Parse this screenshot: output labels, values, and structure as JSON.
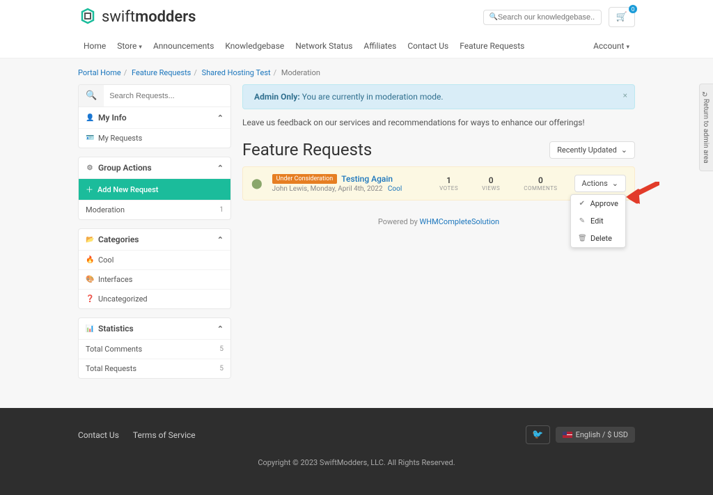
{
  "brand": {
    "part1": "swift",
    "part2": "modders"
  },
  "header": {
    "search_placeholder": "Search our knowledgebase...",
    "cart_count": "0",
    "nav": {
      "home": "Home",
      "store": "Store",
      "announcements": "Announcements",
      "knowledgebase": "Knowledgebase",
      "network_status": "Network Status",
      "affiliates": "Affiliates",
      "contact_us": "Contact Us",
      "feature_requests": "Feature Requests",
      "account": "Account"
    }
  },
  "breadcrumb": {
    "portal_home": "Portal Home",
    "feature_requests": "Feature Requests",
    "shared_hosting_test": "Shared Hosting Test",
    "current": "Moderation"
  },
  "sidebar": {
    "search_placeholder": "Search Requests...",
    "my_info": {
      "title": "My Info",
      "my_requests": "My Requests"
    },
    "group_actions": {
      "title": "Group Actions",
      "add_new": "Add New Request",
      "moderation": "Moderation",
      "moderation_count": "1"
    },
    "categories": {
      "title": "Categories",
      "cool": "Cool",
      "interfaces": "Interfaces",
      "uncategorized": "Uncategorized"
    },
    "statistics": {
      "title": "Statistics",
      "total_comments": "Total Comments",
      "total_comments_n": "5",
      "total_requests": "Total Requests",
      "total_requests_n": "5"
    }
  },
  "main": {
    "alert_label": "Admin Only:",
    "alert_text": "You are currently in moderation mode.",
    "intro": "Leave us feedback on our services and recommendations for ways to enhance our offerings!",
    "heading": "Feature Requests",
    "sort": "Recently Updated",
    "request": {
      "status_badge": "Under Consideration",
      "title": "Testing Again",
      "author": "John Lewis, Monday, April 4th, 2022",
      "category": "Cool",
      "votes": "1",
      "votes_lbl": "VOTES",
      "views": "0",
      "views_lbl": "VIEWS",
      "comments": "0",
      "comments_lbl": "COMMENTS",
      "actions_btn": "Actions",
      "approve": "Approve",
      "edit": "Edit",
      "delete": "Delete"
    },
    "powered_pre": "Powered by ",
    "powered_link": "WHMCompleteSolution"
  },
  "footer": {
    "contact_us": "Contact Us",
    "tos": "Terms of Service",
    "locale": "English / $ USD",
    "copyright": "Copyright © 2023 SwiftModders, LLC. All Rights Reserved."
  },
  "side_tab": "Return to admin area"
}
